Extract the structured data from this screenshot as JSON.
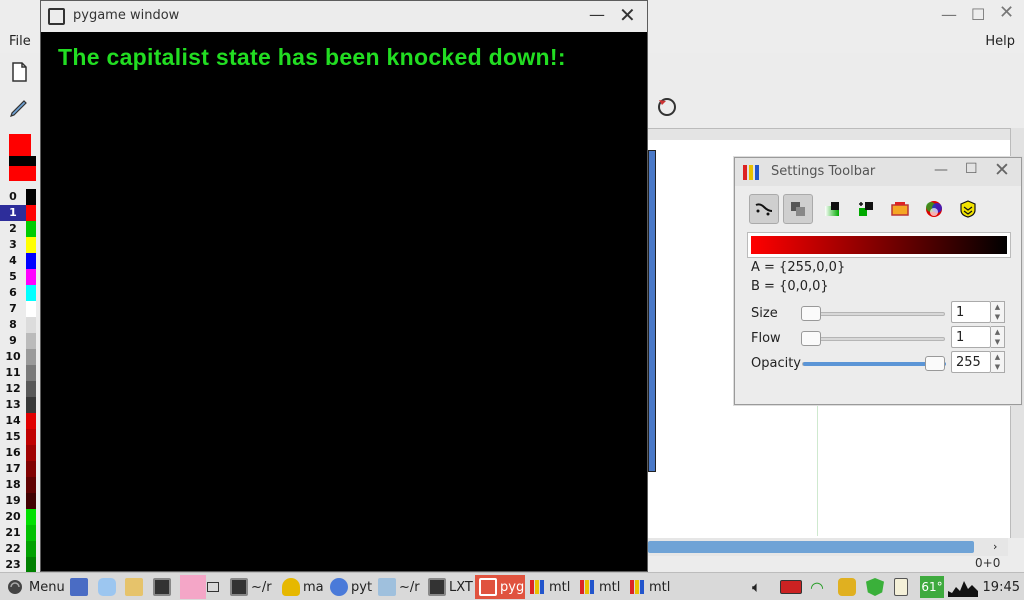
{
  "background_app": {
    "menu": {
      "file": "File",
      "help": "Help"
    },
    "palette": [
      {
        "index": "0",
        "color": "#000000"
      },
      {
        "index": "1",
        "color": "#ff0000",
        "selected": true
      },
      {
        "index": "2",
        "color": "#00cc00"
      },
      {
        "index": "3",
        "color": "#ffff00"
      },
      {
        "index": "4",
        "color": "#0000ff"
      },
      {
        "index": "5",
        "color": "#ff00ff"
      },
      {
        "index": "6",
        "color": "#00ffff"
      },
      {
        "index": "7",
        "color": "#ffffff"
      },
      {
        "index": "8",
        "color": "#dcdcdc"
      },
      {
        "index": "9",
        "color": "#bbbbbb"
      },
      {
        "index": "10",
        "color": "#9a9a9a"
      },
      {
        "index": "11",
        "color": "#7a7a7a"
      },
      {
        "index": "12",
        "color": "#595959"
      },
      {
        "index": "13",
        "color": "#383838"
      },
      {
        "index": "14",
        "color": "#e00000"
      },
      {
        "index": "15",
        "color": "#c00000"
      },
      {
        "index": "16",
        "color": "#a00000"
      },
      {
        "index": "17",
        "color": "#800000"
      },
      {
        "index": "18",
        "color": "#600000"
      },
      {
        "index": "19",
        "color": "#400000"
      },
      {
        "index": "20",
        "color": "#00e000"
      },
      {
        "index": "21",
        "color": "#00c000"
      },
      {
        "index": "22",
        "color": "#00a000"
      },
      {
        "index": "23",
        "color": "#008000"
      }
    ],
    "status_coords": "0+0"
  },
  "pygame_window": {
    "title": "pygame window",
    "message": "The capitalist state has been knocked down!:",
    "message_color": "#22dd22"
  },
  "settings_toolbar": {
    "title": "Settings Toolbar",
    "color_a": "A = {255,0,0}",
    "color_b": "B = {0,0,0}",
    "size_label": "Size",
    "size_value": "1",
    "flow_label": "Flow",
    "flow_value": "1",
    "opacity_label": "Opacity",
    "opacity_value": "255",
    "opacity_fraction": 1.0
  },
  "taskbar": {
    "menu_label": "Menu",
    "items": [
      {
        "label": "~/r"
      },
      {
        "label": "ma"
      },
      {
        "label": "pyt"
      },
      {
        "label": "~/r"
      },
      {
        "label": "LXT"
      },
      {
        "label": "pyg"
      },
      {
        "label": "mtl"
      },
      {
        "label": "mtl"
      },
      {
        "label": "mtl"
      }
    ],
    "temperature": "61°",
    "clock": "19:45"
  }
}
